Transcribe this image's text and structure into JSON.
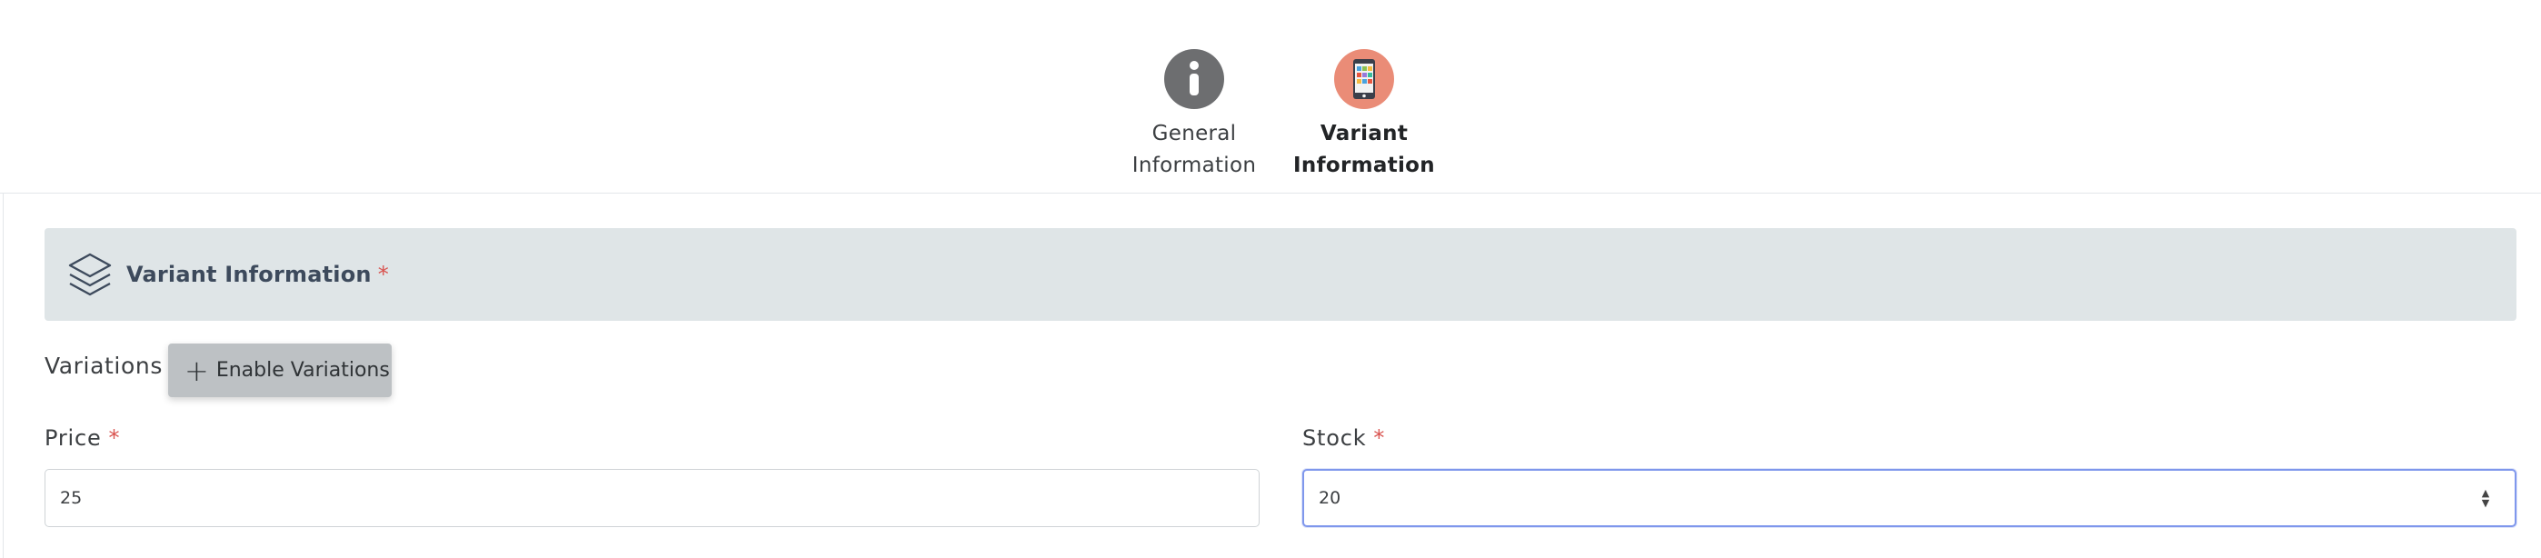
{
  "stepper": {
    "steps": [
      {
        "label_line1": "General",
        "label_line2": "Information",
        "icon": "info-icon",
        "color": "#6d6e70",
        "active": false
      },
      {
        "label_line1": "Variant",
        "label_line2": "Information",
        "icon": "tablet-icon",
        "color": "#ea8c77",
        "active": true
      }
    ]
  },
  "section": {
    "icon": "layers-icon",
    "title": "Variant Information",
    "required_mark": "*"
  },
  "variations": {
    "label": "Variations",
    "button_icon": "plus-icon",
    "button_label": "Enable Variations"
  },
  "fields": {
    "price": {
      "label": "Price",
      "required_mark": "*",
      "value": "25"
    },
    "stock": {
      "label": "Stock",
      "required_mark": "*",
      "value": "20"
    }
  },
  "colors": {
    "accent": "#ea8c77",
    "required": "#d9534f",
    "focus_border": "#7f97ec",
    "section_bg": "#dfe5e7"
  }
}
